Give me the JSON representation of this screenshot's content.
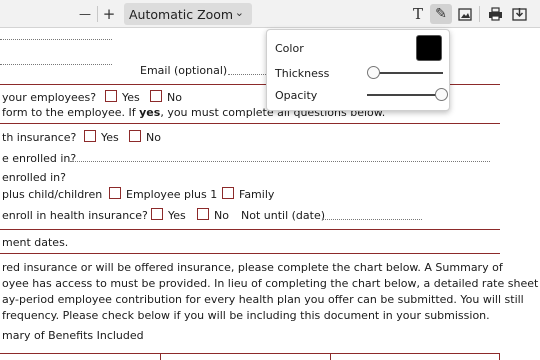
{
  "toolbar": {
    "zoom_out_glyph": "—",
    "zoom_in_glyph": "+",
    "zoom_value": "Automatic Zoom",
    "text_tool_glyph": "T",
    "draw_tool_glyph": "✎",
    "print_glyph": "⎙",
    "save_glyph": "⤓"
  },
  "popup": {
    "color_label": "Color",
    "color_value": "#000000",
    "thickness_label": "Thickness",
    "thickness_value": 0.0,
    "opacity_label": "Opacity",
    "opacity_value": 1.0
  },
  "form": {
    "email_label": "Email (optional)",
    "q_employees": "your employees?",
    "yes": "Yes",
    "no": "No",
    "form_line_a": "form to the employee. If ",
    "form_line_yes": "yes",
    "form_line_b": ", you must complete all questions below.",
    "q_health": "th insurance?",
    "q_enrolled": "e enrolled in?",
    "q_enrolled_in": "enrolled in?",
    "opt_child": "plus child/children",
    "opt_plus1": "Employee plus 1",
    "opt_family": "Family",
    "q_enroll_health": "enroll in health insurance?",
    "not_until": "Not until (date)",
    "enrollment_dates": "ment dates.",
    "para_1": "red insurance or will be offered insurance, please complete the chart below. A Summary of",
    "para_2": "oyee has access to must be provided. In lieu of completing the chart below, a detailed rate sheet",
    "para_3": "ay-period employee contribution for every health plan you offer can be submitted. You will still",
    "para_4": "frequency. Please check below if you will be including this document in your submission.",
    "summary_label": "mary of Benefits Included"
  }
}
